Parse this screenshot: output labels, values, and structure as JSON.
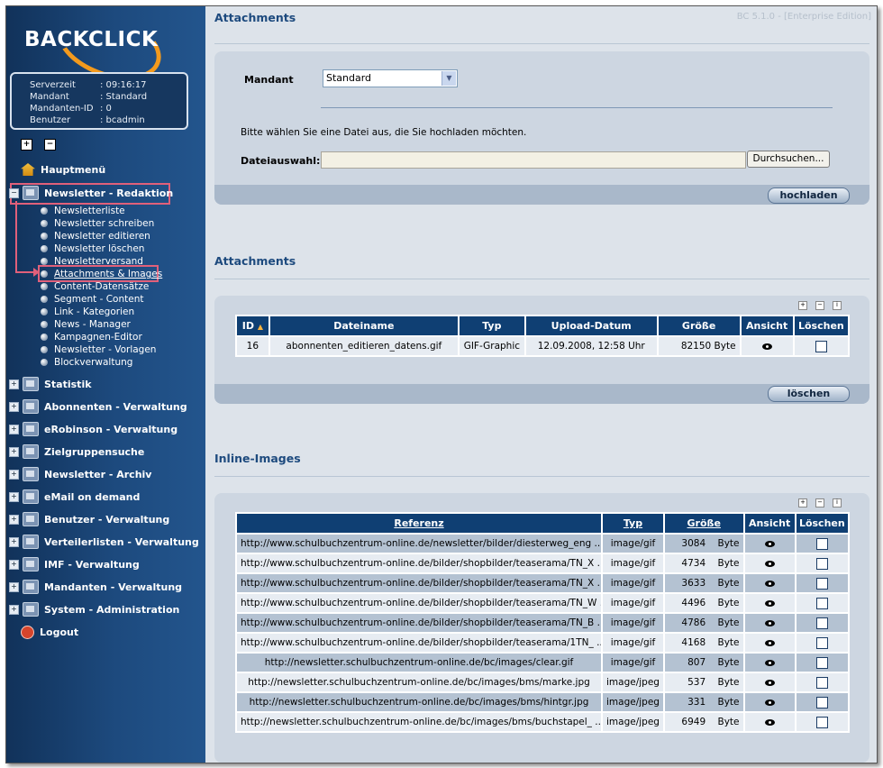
{
  "logo": {
    "text": "BACKCLICK"
  },
  "info": [
    {
      "key": "Serverzeit",
      "value": ": 09:16:17"
    },
    {
      "key": "Mandant",
      "value": ": Standard"
    },
    {
      "key": "Mandanten-ID",
      "value": ": 0"
    },
    {
      "key": "Benutzer",
      "value": ": bcadmin"
    }
  ],
  "sidebar": {
    "home": "Hauptmenü",
    "newsletter_section": "Newsletter - Redaktion",
    "sub": [
      "Newsletterliste",
      "Newsletter schreiben",
      "Newsletter editieren",
      "Newsletter löschen",
      "Newsletterversand",
      "Attachments & Images",
      "Content-Datensätze",
      "Segment - Content",
      "Link - Kategorien",
      "News - Manager",
      "Kampagnen-Editor",
      "Newsletter - Vorlagen",
      "Blockverwaltung"
    ],
    "sections": [
      "Statistik",
      "Abonnenten - Verwaltung",
      "eRobinson - Verwaltung",
      "Zielgruppensuche",
      "Newsletter - Archiv",
      "eMail on demand",
      "Benutzer - Verwaltung",
      "Verteilerlisten - Verwaltung",
      "IMF - Verwaltung",
      "Mandanten - Verwaltung",
      "System - Administration"
    ],
    "logout": "Logout"
  },
  "main": {
    "title": "Attachments",
    "version": "BC 5.1.0 - [Enterprise Edition]",
    "upload": {
      "mandant_label": "Mandant",
      "mandant_value": "Standard",
      "instruction": "Bitte wählen Sie eine Datei aus, die Sie hochladen möchten.",
      "file_label": "Dateiauswahl:",
      "browse_button": "Durchsuchen...",
      "upload_button": "hochladen"
    },
    "attachments": {
      "title": "Attachments",
      "headers": [
        "ID",
        "Dateiname",
        "Typ",
        "Upload-Datum",
        "Größe",
        "Ansicht",
        "Löschen"
      ],
      "rows": [
        {
          "id": "16",
          "name": "abonnenten_editieren_datens.gif",
          "type": "GIF-Graphic",
          "date": "12.09.2008, 12:58 Uhr",
          "size": "82150 Byte"
        }
      ],
      "delete_button": "löschen"
    },
    "inline": {
      "title": "Inline-Images",
      "headers": [
        "Referenz",
        "Typ",
        "Größe",
        "Ansicht",
        "Löschen"
      ],
      "unit": "Byte",
      "rows": [
        {
          "ref": "http://www.schulbuchzentrum-online.de/newsletter/bilder/diesterweg_eng ...",
          "type": "image/gif",
          "size": "3084"
        },
        {
          "ref": "http://www.schulbuchzentrum-online.de/bilder/shopbilder/teaserama/TN_X ...",
          "type": "image/gif",
          "size": "4734"
        },
        {
          "ref": "http://www.schulbuchzentrum-online.de/bilder/shopbilder/teaserama/TN_X ...",
          "type": "image/gif",
          "size": "3633"
        },
        {
          "ref": "http://www.schulbuchzentrum-online.de/bilder/shopbilder/teaserama/TN_W ...",
          "type": "image/gif",
          "size": "4496"
        },
        {
          "ref": "http://www.schulbuchzentrum-online.de/bilder/shopbilder/teaserama/TN_B ...",
          "type": "image/gif",
          "size": "4786"
        },
        {
          "ref": "http://www.schulbuchzentrum-online.de/bilder/shopbilder/teaserama/1TN_ ...",
          "type": "image/gif",
          "size": "4168"
        },
        {
          "ref": "http://newsletter.schulbuchzentrum-online.de/bc/images/clear.gif",
          "type": "image/gif",
          "size": "807"
        },
        {
          "ref": "http://newsletter.schulbuchzentrum-online.de/bc/images/bms/marke.jpg",
          "type": "image/jpeg",
          "size": "537"
        },
        {
          "ref": "http://newsletter.schulbuchzentrum-online.de/bc/images/bms/hintgr.jpg",
          "type": "image/jpeg",
          "size": "331"
        },
        {
          "ref": "http://newsletter.schulbuchzentrum-online.de/bc/images/bms/buchstapel_ ...",
          "type": "image/jpeg",
          "size": "6949"
        }
      ]
    }
  }
}
